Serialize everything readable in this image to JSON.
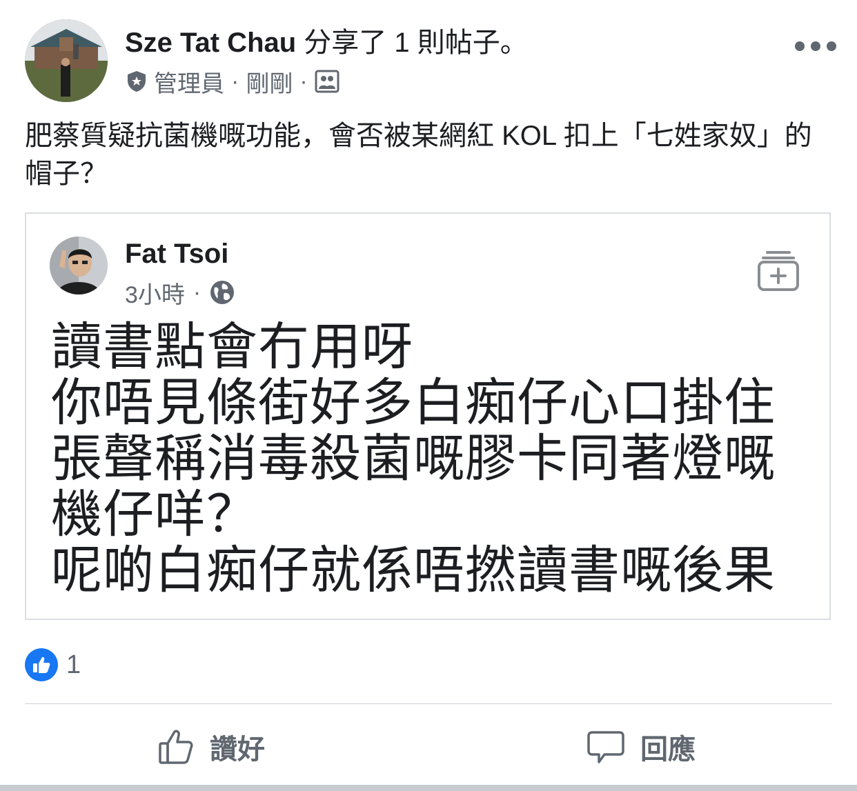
{
  "post": {
    "author": "Sze Tat Chau",
    "action_text": " 分享了 1 則帖子。",
    "role": "管理員",
    "time": "剛剛",
    "audience_icon": "group-icon",
    "text": "肥蔡質疑抗菌機嘅功能，會否被某網紅 KOL 扣上「七姓家奴」的帽子？"
  },
  "shared": {
    "author": "Fat Tsoi",
    "time": "3小時",
    "audience_icon": "globe-icon",
    "text": "讀書點會冇用呀\n你唔見條街好多白痴仔心口掛住張聲稱消毒殺菌嘅膠卡同著燈嘅機仔咩？\n呢啲白痴仔就係唔撚讀書嘅後果"
  },
  "reactions": {
    "count": "1",
    "icon": "like-icon"
  },
  "actions": {
    "like": "讚好",
    "comment": "回應"
  },
  "colors": {
    "accent": "#1877f2",
    "secondary_text": "#606770"
  }
}
